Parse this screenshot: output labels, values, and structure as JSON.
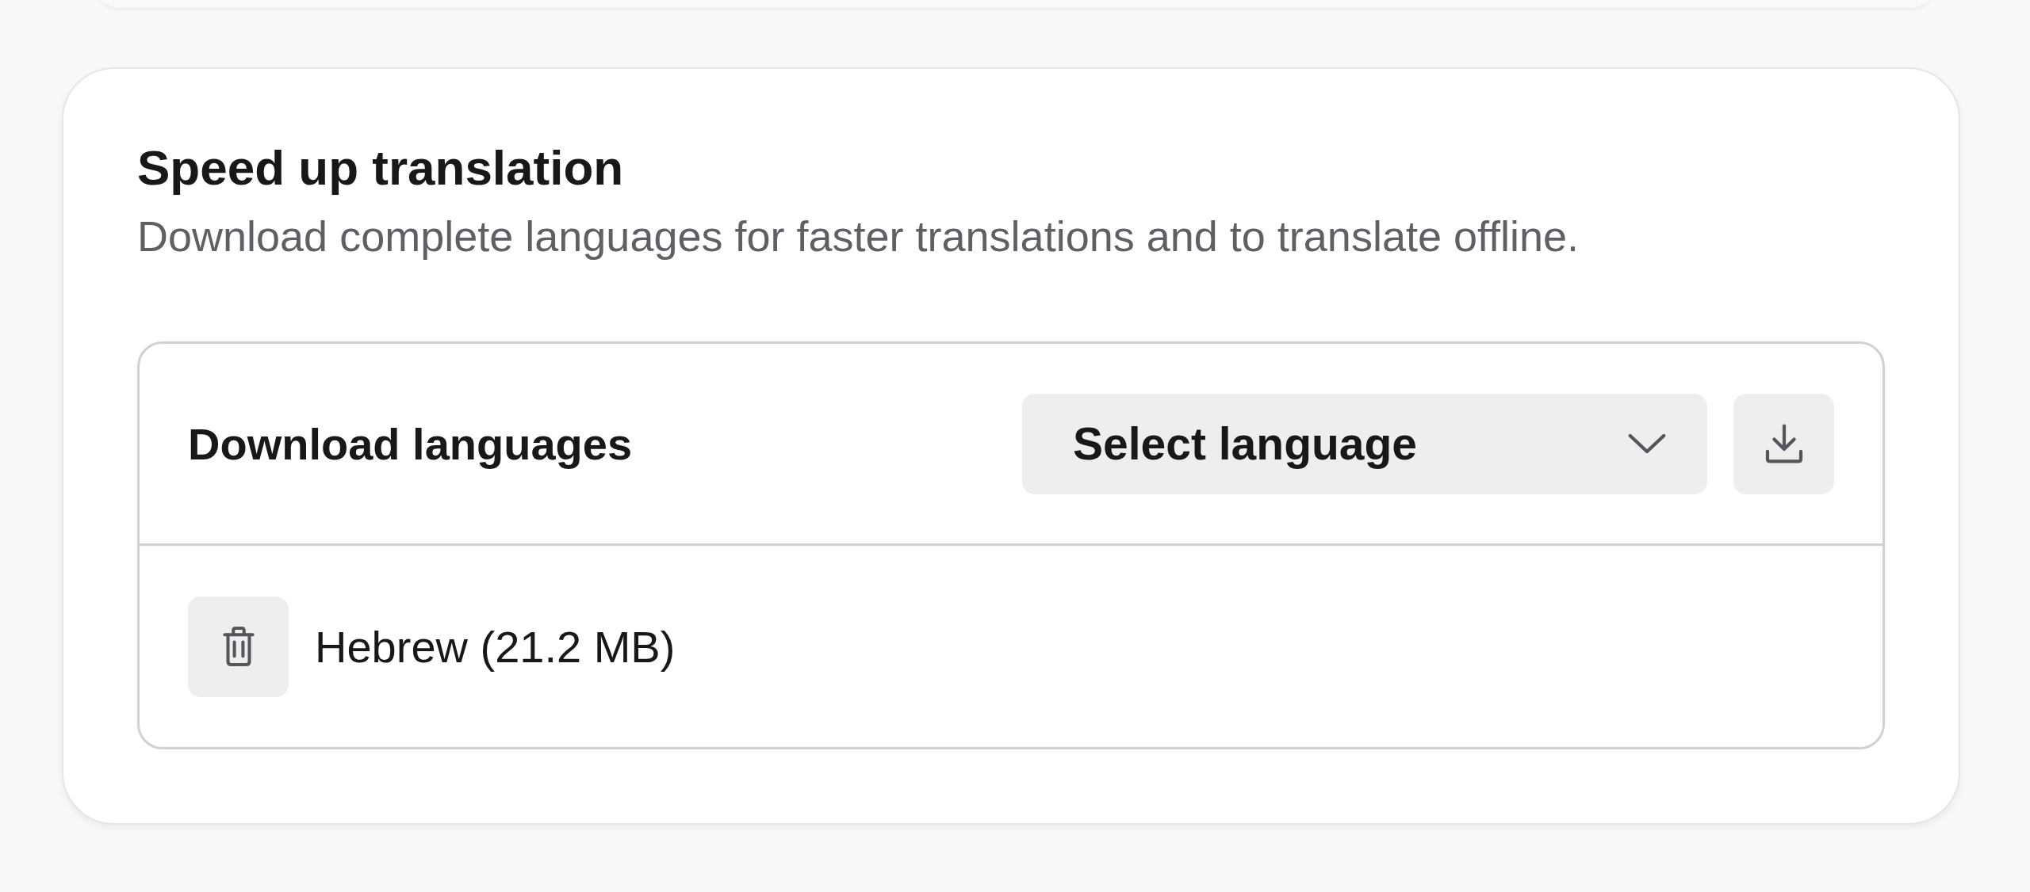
{
  "card": {
    "title": "Speed up translation",
    "description": "Download complete languages for faster translations and to translate offline."
  },
  "download": {
    "label": "Download languages",
    "select": {
      "placeholder": "Select language"
    }
  },
  "languages": [
    {
      "name": "Hebrew (21.2 MB)"
    }
  ]
}
